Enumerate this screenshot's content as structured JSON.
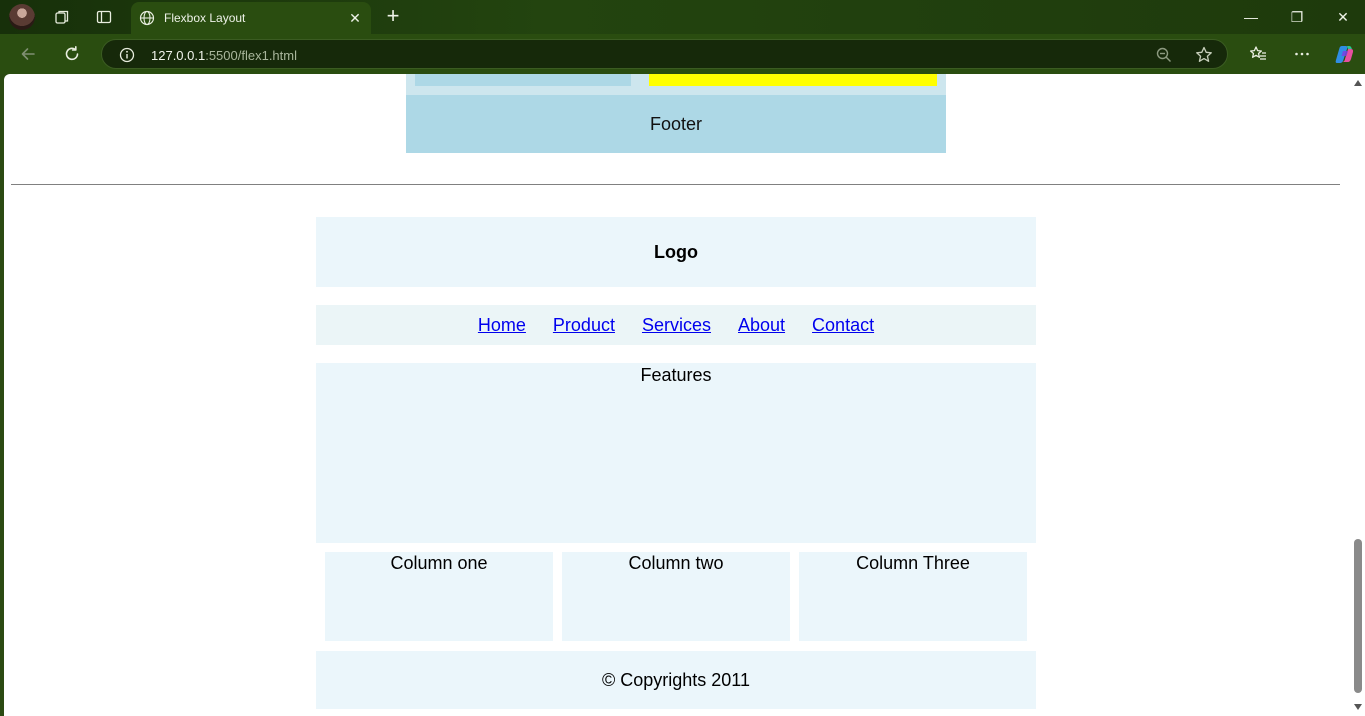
{
  "browser": {
    "tab_title": "Flexbox Layout",
    "tab_close": "✕",
    "new_tab": "+",
    "url_host": "127.0.0.1",
    "url_rest": ":5500/flex1.html",
    "window_minimize": "—",
    "window_restore": "❐",
    "window_close": "✕",
    "icons": [
      "profile-avatar",
      "workspaces-icon",
      "tab-actions-icon",
      "globe-icon",
      "back-arrow-icon",
      "refresh-icon",
      "info-icon",
      "zoom-out-icon",
      "star-icon",
      "favorites-icon",
      "more-icon",
      "copilot-icon"
    ]
  },
  "previous_layout": {
    "footer": "Footer",
    "colors": {
      "left": "#add8e6",
      "right": "#ffff00",
      "footer": "#add8e6"
    }
  },
  "layout": {
    "logo": "Logo",
    "nav": [
      {
        "label": "Home"
      },
      {
        "label": "Product"
      },
      {
        "label": "Services"
      },
      {
        "label": "About"
      },
      {
        "label": "Contact"
      }
    ],
    "features": "Features",
    "columns": [
      {
        "title": "Column one"
      },
      {
        "title": "Column two"
      },
      {
        "title": "Column Three"
      }
    ],
    "copyright": "© Copyrights 2011"
  },
  "colors": {
    "panel": "#ebf6fb",
    "link": "#0000ee",
    "chrome": "#2a4d10"
  }
}
